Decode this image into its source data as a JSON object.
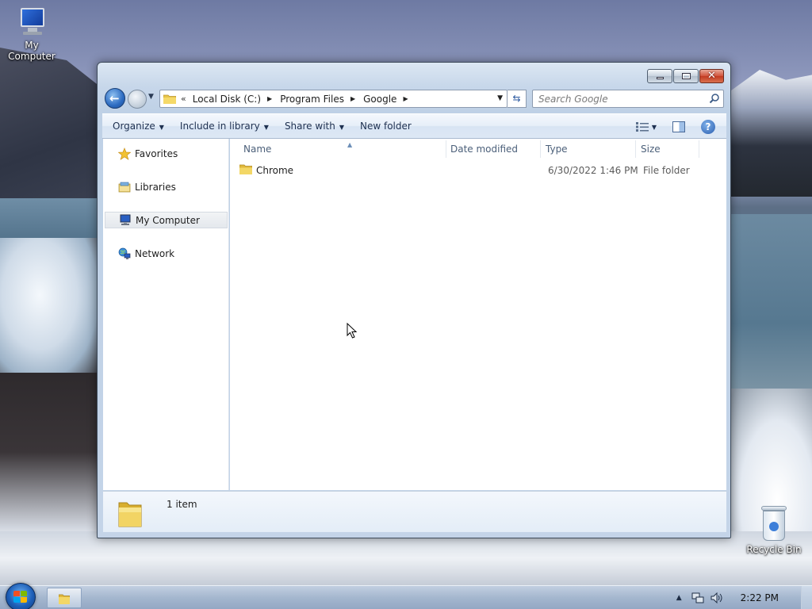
{
  "desktop": {
    "icons": [
      {
        "label": "My Computer"
      },
      {
        "label": "Recycle Bin"
      }
    ]
  },
  "window": {
    "address": {
      "overflow": "«",
      "segments": [
        "Local Disk (C:)",
        "Program Files",
        "Google"
      ]
    },
    "search": {
      "placeholder": "Search Google"
    },
    "commands": {
      "organize": "Organize",
      "include_in_library": "Include in library",
      "share_with": "Share with",
      "new_folder": "New folder"
    },
    "nav_pane": [
      {
        "label": "Favorites",
        "icon": "star-icon"
      },
      {
        "label": "Libraries",
        "icon": "libraries-icon"
      },
      {
        "label": "My Computer",
        "icon": "computer-icon",
        "selected": true
      },
      {
        "label": "Network",
        "icon": "network-icon"
      }
    ],
    "columns": [
      "Name",
      "Date modified",
      "Type",
      "Size"
    ],
    "files": [
      {
        "name": "Chrome",
        "date_modified": "6/30/2022 1:46 PM",
        "type": "File folder",
        "size": ""
      }
    ],
    "details": {
      "count": "1 item"
    }
  },
  "taskbar": {
    "clock": "2:22 PM"
  },
  "colors": {
    "folder": "#e8c54a",
    "accent": "#2c6bc1",
    "cmdbar_text": "#1e3050",
    "column_header": "#4c607a"
  }
}
